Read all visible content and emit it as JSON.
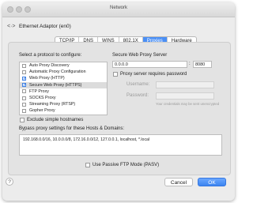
{
  "window": {
    "title": "Network",
    "adapter": "Ethernet Adaptor (en0)"
  },
  "tabs": [
    {
      "label": "TCP/IP"
    },
    {
      "label": "DNS"
    },
    {
      "label": "WINS"
    },
    {
      "label": "802.1X"
    },
    {
      "label": "Proxies",
      "active": true
    },
    {
      "label": "Hardware"
    }
  ],
  "protocols": {
    "heading": "Select a protocol to configure:",
    "items": [
      {
        "label": "Auto Proxy Discovery",
        "checked": false
      },
      {
        "label": "Automatic Proxy Configuration",
        "checked": false
      },
      {
        "label": "Web Proxy (HTTP)",
        "checked": true
      },
      {
        "label": "Secure Web Proxy (HTTPS)",
        "checked": true,
        "selected": true
      },
      {
        "label": "FTP Proxy",
        "checked": false
      },
      {
        "label": "SOCKS Proxy",
        "checked": false
      },
      {
        "label": "Streaming Proxy (RTSP)",
        "checked": false
      },
      {
        "label": "Gopher Proxy",
        "checked": false
      }
    ]
  },
  "server": {
    "heading": "Secure Web Proxy Server",
    "address": "0.0.0.0",
    "colon": ":",
    "port": "8080",
    "requires_password_label": "Proxy server requires password",
    "username_label": "Username:",
    "password_label": "Password:",
    "note": "Your credentials may be sent unencrypted"
  },
  "exclude_simple": {
    "label": "Exclude simple hostnames",
    "checked": false
  },
  "bypass": {
    "label": "Bypass proxy settings for these Hosts & Domains:",
    "value": "192.168.0.0/16, 10.0.0.0/8, 172.16.0.0/12, 127.0.0.1, localhost, *.local"
  },
  "passive_ftp": {
    "label": "Use Passive FTP Mode (PASV)",
    "checked": false
  },
  "buttons": {
    "help": "?",
    "cancel": "Cancel",
    "ok": "OK"
  },
  "colors": {
    "accent": "#4a8ff5",
    "check": "#1d6ef0"
  }
}
